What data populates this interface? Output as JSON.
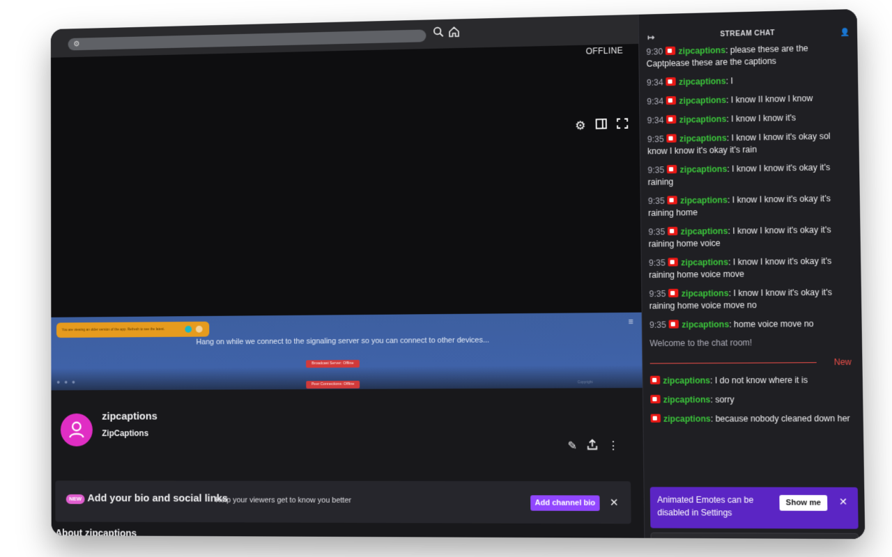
{
  "browser": {
    "url_icon": "tune-icon",
    "search_icon": "search-icon",
    "home_icon": "home-icon"
  },
  "window_controls": {
    "minimize": "_",
    "maximize": "☐",
    "close": "✕"
  },
  "video": {
    "status": "OFFLINE",
    "embedded_app": {
      "old_version_notice": "You are viewing an older version of the app. Refresh to see the latest.",
      "connect_message": "Hang on while we connect to the signaling server so you can connect to other devices...",
      "broadcast_status": "Broadcast Server: Offline",
      "peer_status": "Peer Connections: Offline",
      "copyright": "Copyright"
    }
  },
  "channel": {
    "name": "zipcaptions",
    "display_name": "ZipCaptions",
    "avatar_color": "#e02ec4"
  },
  "bio_prompt": {
    "badge": "NEW",
    "title": "Add your bio and social links",
    "help": "Help your viewers get to know you better",
    "button": "Add channel bio",
    "close": "✕"
  },
  "about_heading": "About zipcaptions",
  "chat": {
    "header": "STREAM CHAT",
    "messages": [
      {
        "time": "9:30",
        "user": "zipcaptions",
        "text": ": please these are the Captplease these are the captions"
      },
      {
        "time": "9:34",
        "user": "zipcaptions",
        "text": ": I"
      },
      {
        "time": "9:34",
        "user": "zipcaptions",
        "text": ": I know II know I know"
      },
      {
        "time": "9:34",
        "user": "zipcaptions",
        "text": ": I know I know it's"
      },
      {
        "time": "9:35",
        "user": "zipcaptions",
        "text": ": I know I know it's okay sol know I know it's okay it's rain"
      },
      {
        "time": "9:35",
        "user": "zipcaptions",
        "text": ": I know I know it's okay it's raining"
      },
      {
        "time": "9:35",
        "user": "zipcaptions",
        "text": ": I know I know it's okay it's raining home"
      },
      {
        "time": "9:35",
        "user": "zipcaptions",
        "text": ": I know I know it's okay it's raining home voice"
      },
      {
        "time": "9:35",
        "user": "zipcaptions",
        "text": ": I know I know it's okay it's raining home voice move"
      },
      {
        "time": "9:35",
        "user": "zipcaptions",
        "text": ": I know I know it's okay it's raining home voice move no"
      },
      {
        "time": "9:35",
        "user": "zipcaptions",
        "text": ": home voice move no"
      }
    ],
    "welcome": "Welcome to the chat room!",
    "new_label": "New",
    "new_messages": [
      {
        "user": "zipcaptions",
        "text": ": I do not know where it is"
      },
      {
        "user": "zipcaptions",
        "text": ": sorry"
      },
      {
        "user": "zipcaptions",
        "text": ": because nobody cleaned down her"
      }
    ],
    "emote_banner": {
      "text": "Animated Emotes can be disabled in Settings",
      "button": "Show me",
      "close": "✕"
    }
  },
  "colors": {
    "accent": "#9147ff",
    "username": "#3bc43b",
    "badge": "#e91916",
    "new_divider": "#eb4e48",
    "embed_blue": "#3f62a8"
  }
}
